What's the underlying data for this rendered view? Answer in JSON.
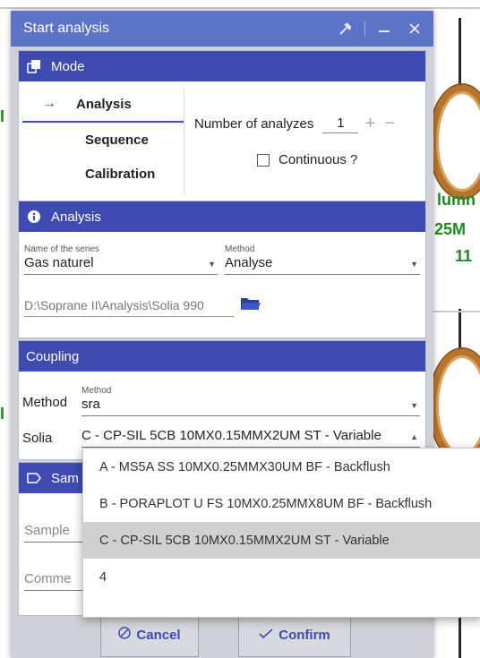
{
  "background": {
    "texts": [
      "lumn",
      ".25M",
      "11"
    ],
    "left_glyphs": [
      "I",
      "I",
      "I"
    ]
  },
  "dialog": {
    "title": "Start analysis",
    "mode": {
      "header": "Mode",
      "items": [
        {
          "label": "Analysis",
          "selected": true
        },
        {
          "label": "Sequence",
          "selected": false
        },
        {
          "label": "Calibration",
          "selected": false
        }
      ],
      "number_label": "Number of analyzes",
      "number_value": "1",
      "continuous_label": "Continuous ?"
    },
    "analysis": {
      "header": "Analysis",
      "series_label": "Name of the series",
      "series_value": "Gas naturel",
      "method_label": "Method",
      "method_value": "Analyse",
      "path_value": "D:\\Soprane II\\Analysis\\Solia 990"
    },
    "coupling": {
      "header": "Coupling",
      "method_row_label": "Method",
      "method_field_label": "Method",
      "method_value": "sra",
      "solia_label": "Solia",
      "solia_value": "C - CP-SIL 5CB 10MX0.15MMX2UM ST - Variable"
    },
    "sample": {
      "header_partial": "Sam",
      "sample_partial": "Sample",
      "comment_partial": "Comme"
    },
    "dropdown_options": [
      {
        "label": "A - MS5A SS 10MX0.25MMX30UM BF - Backflush",
        "highlighted": false
      },
      {
        "label": "B - PORAPLOT U FS 10MX0.25MMX8UM BF - Backflush",
        "highlighted": false
      },
      {
        "label": "C - CP-SIL 5CB 10MX0.15MMX2UM ST - Variable",
        "highlighted": true
      },
      {
        "label": "4",
        "highlighted": false
      }
    ],
    "buttons": {
      "cancel": "Cancel",
      "confirm": "Confirm"
    }
  },
  "colors": {
    "title_bar": "#5b74c7",
    "section_header": "#3f4bb0",
    "highlight": "#d0d0d0",
    "background_text": "#1f8a1f"
  }
}
